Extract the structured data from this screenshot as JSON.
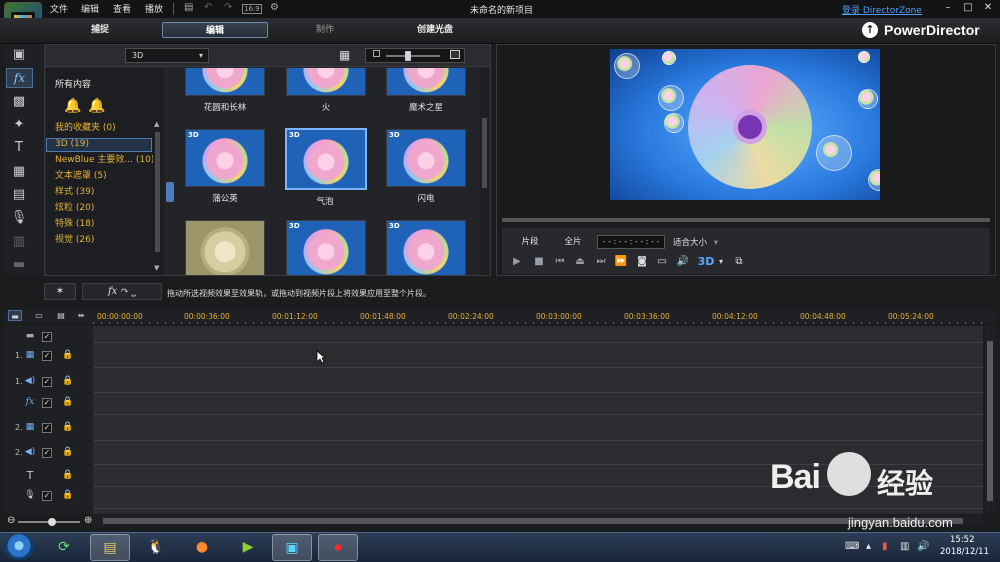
{
  "menu": [
    "文件",
    "编辑",
    "查看",
    "播放"
  ],
  "aspect_badge": "16:9",
  "project_title": "未命名的新项目",
  "login_link": "登录 DirectorZone",
  "mode_tabs": [
    "捕捉",
    "编辑",
    "制作",
    "创建光盘"
  ],
  "brand": "PowerDirector",
  "library": {
    "category": "3D",
    "tree_title": "所有内容",
    "tree_items": [
      "我的收藏夹 (0)",
      "3D (19)",
      "NewBlue 主要效... (10)",
      "文本遮罩 (5)",
      "样式 (39)",
      "炫粒 (20)",
      "特殊 (18)",
      "视觉 (26)"
    ],
    "effects": [
      {
        "name": "花圆和长林",
        "badge": ""
      },
      {
        "name": "火",
        "badge": ""
      },
      {
        "name": "魔术之星",
        "badge": ""
      },
      {
        "name": "蒲公英",
        "badge": "3D"
      },
      {
        "name": "气泡",
        "badge": "3D"
      },
      {
        "name": "闪电",
        "badge": "3D"
      },
      {
        "name": "",
        "badge": ""
      },
      {
        "name": "",
        "badge": "3D"
      },
      {
        "name": "",
        "badge": "3D"
      }
    ]
  },
  "preview": {
    "clip_label": "片段",
    "full_label": "全片",
    "timecode": "- - : - - : - - : - -",
    "fit_label": "适合大小",
    "mode_3d": "3D"
  },
  "hint": "拖动所选视频效果至效果轨，或拖动到视频片段上将效果应用至整个片段。",
  "timeline": {
    "ticks": [
      "00:00:00:00",
      "00:00:36:00",
      "00:01:12:00",
      "00:01:48:00",
      "00:02:24:00",
      "00:03:00:00",
      "00:03:36:00",
      "00:04:12:00",
      "00:04:48:00",
      "00:05:24:00"
    ],
    "track_numbers": [
      "1.",
      "1.",
      "",
      "2.",
      "2.",
      "",
      ""
    ]
  },
  "clock": {
    "time": "15:52",
    "date": "2018/12/11"
  },
  "watermark": {
    "logo": "Bai du",
    "text": "经验",
    "url": "jingyan.baidu.com"
  }
}
